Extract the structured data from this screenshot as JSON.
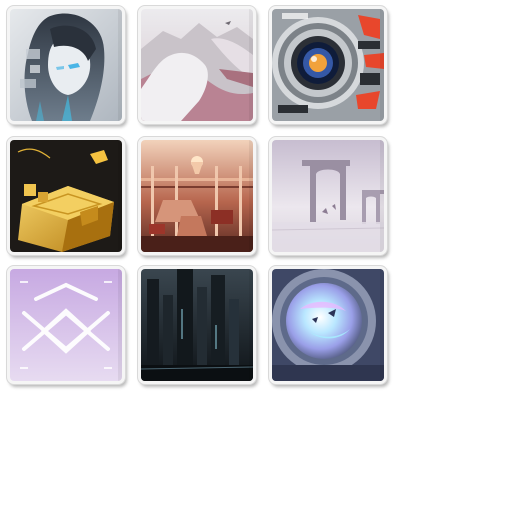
{
  "tiles": [
    {
      "subject": "anime-girl-portrait",
      "palette": {
        "bg": "#c9cfd6",
        "accent": "#3ec7f0"
      }
    },
    {
      "subject": "snowy-mountain-ridge",
      "palette": {
        "bg": "#d8c9d2",
        "accent": "#c17d8d"
      }
    },
    {
      "subject": "mechanical-lens-eye",
      "palette": {
        "bg": "#8a8f95",
        "accent": "#e8472c"
      }
    },
    {
      "subject": "golden-cube-block",
      "palette": {
        "bg": "#1d1a17",
        "accent": "#e1b237"
      }
    },
    {
      "subject": "grand-hall-interior",
      "palette": {
        "bg": "#6b3a30",
        "accent": "#f3c9a9"
      }
    },
    {
      "subject": "ruined-arches-misty-sea",
      "palette": {
        "bg": "#c9bfd2",
        "accent": "#8c7c93"
      }
    },
    {
      "subject": "lattice-emblem",
      "palette": {
        "bg": "#cdb5e3",
        "accent": "#ffffff"
      }
    },
    {
      "subject": "dark-cyber-pillars",
      "palette": {
        "bg": "#1c2328",
        "accent": "#7fb5c4"
      }
    },
    {
      "subject": "holographic-portal-ring",
      "palette": {
        "bg": "#5e6a8a",
        "accent": "#b9e7ff"
      }
    }
  ]
}
